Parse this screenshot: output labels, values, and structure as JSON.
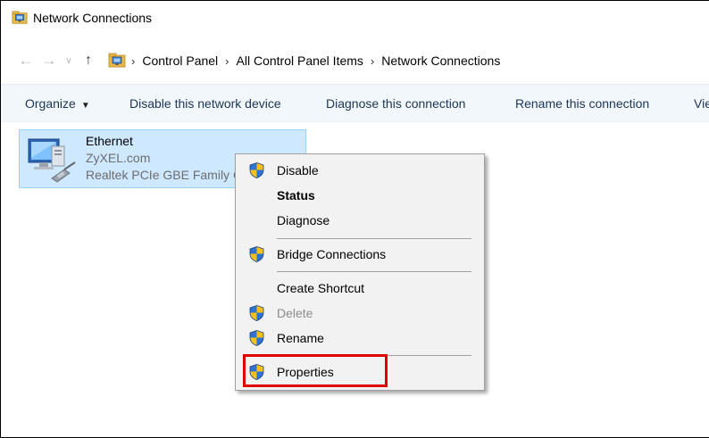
{
  "window": {
    "title": "Network Connections"
  },
  "address": {
    "crumbs": [
      "Control Panel",
      "All Control Panel Items",
      "Network Connections"
    ]
  },
  "commands": {
    "organize": "Organize",
    "disable": "Disable this network device",
    "diagnose": "Diagnose this connection",
    "rename": "Rename this connection",
    "view": "Vie"
  },
  "connection": {
    "name": "Ethernet",
    "network": "ZyXEL.com",
    "adapter": "Realtek PCIe GBE Family C"
  },
  "context_menu": {
    "items": [
      {
        "label": "Disable",
        "icon": "shield-icon"
      },
      {
        "label": "Status",
        "bold": true
      },
      {
        "label": "Diagnose"
      },
      {
        "label": "Bridge Connections",
        "icon": "shield-icon"
      },
      {
        "label": "Create Shortcut"
      },
      {
        "label": "Delete",
        "icon": "shield-icon",
        "disabled": true
      },
      {
        "label": "Rename",
        "icon": "shield-icon"
      },
      {
        "label": "Properties",
        "icon": "shield-icon",
        "highlighted": true
      }
    ]
  },
  "colors": {
    "selection_bg": "#cde8ff",
    "command_bar_bg": "#f2f7fc",
    "highlight_box": "#e00000"
  }
}
